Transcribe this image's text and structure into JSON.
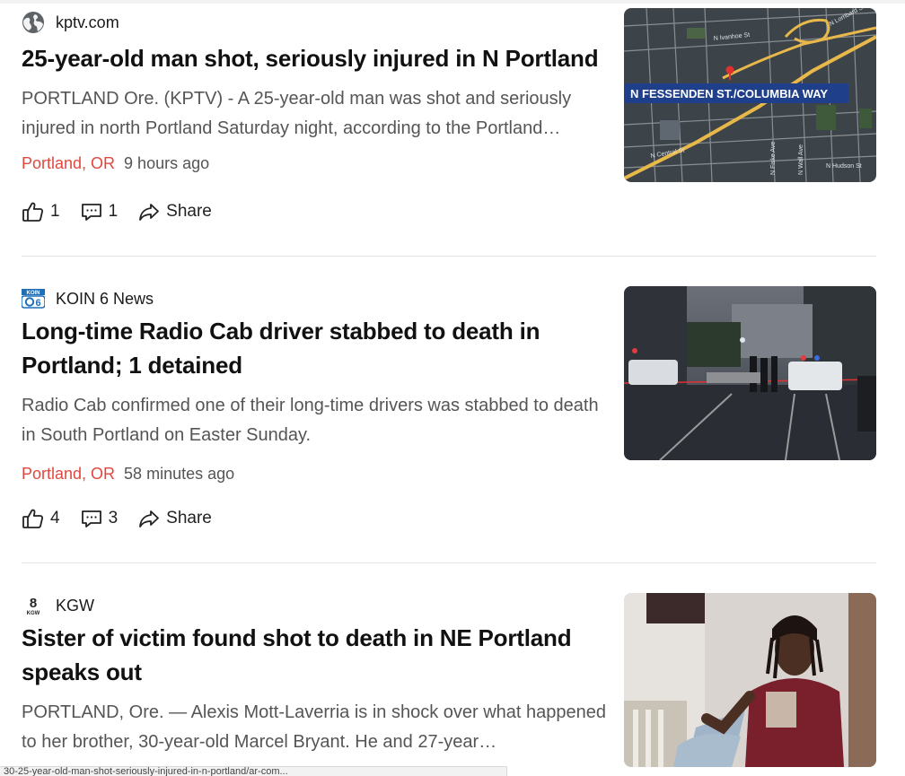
{
  "articles": [
    {
      "source": "kptv.com",
      "source_icon": "globe-icon",
      "title": "25-year-old man shot, seriously injured in N Portland",
      "snippet": "PORTLAND Ore. (KPTV) - A 25-year-old man was shot and seriously injured in north Portland Saturday night, according to the Portland…",
      "location": "Portland, OR",
      "time": "9 hours ago",
      "likes": "1",
      "comments": "1",
      "share": "Share",
      "thumb_banner": "N FESSENDEN ST./COLUMBIA WAY",
      "thumb_streets": [
        "N Ivanhoe St",
        "N Central St",
        "N Hudson St",
        "N Fiske Ave",
        "N Wall Ave",
        "N Lombard St"
      ]
    },
    {
      "source": "KOIN 6 News",
      "source_icon": "koin-logo",
      "source_logo_text": "KOIN",
      "source_logo_number": "6",
      "title": "Long-time Radio Cab driver stabbed to death in Portland; 1 detained",
      "snippet": "Radio Cab confirmed one of their long-time drivers was stabbed to death in South Portland on Easter Sunday.",
      "location": "Portland, OR",
      "time": "58 minutes ago",
      "likes": "4",
      "comments": "3",
      "share": "Share"
    },
    {
      "source": "KGW",
      "source_icon": "kgw-logo",
      "source_logo_text": "8",
      "source_logo_sub": "KGW",
      "title": "Sister of victim found shot to death in NE Portland speaks out",
      "snippet": "PORTLAND, Ore. — Alexis Mott-Laverria is in shock over what happened to her brother, 30-year-old Marcel Bryant. He and 27-year…"
    }
  ],
  "status_bar": "30-25-year-old-man-shot-seriously-injured-in-n-portland/ar-com..."
}
